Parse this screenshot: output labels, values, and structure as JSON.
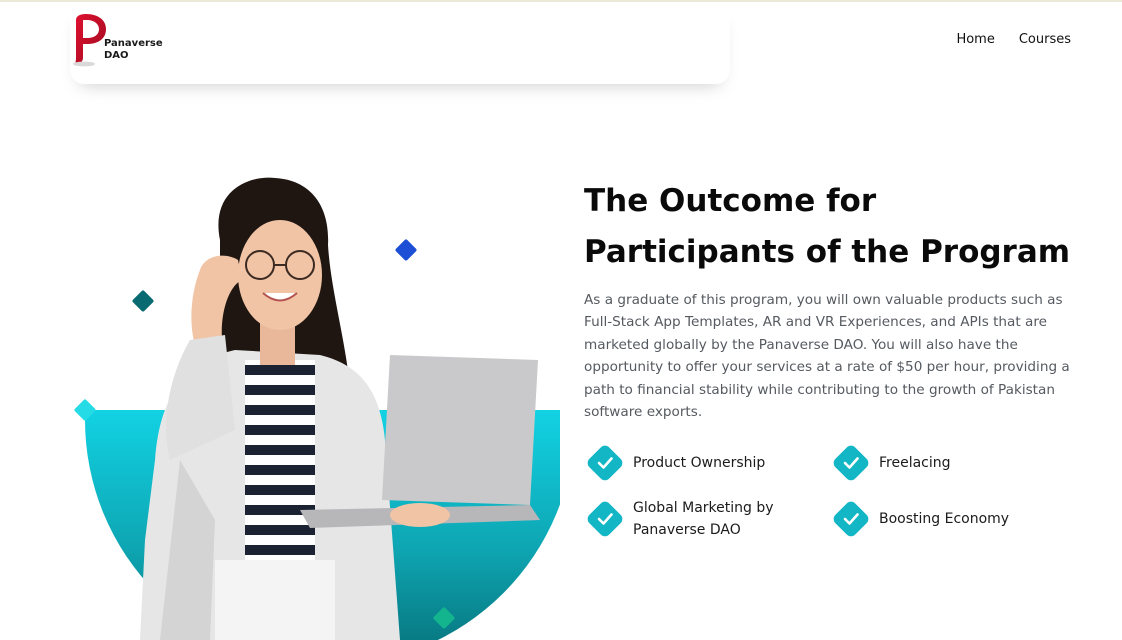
{
  "brand": {
    "line1": "Panaverse",
    "line2": "DAO",
    "logo_color": "#c8102e"
  },
  "nav": [
    {
      "label": "Home"
    },
    {
      "label": "Courses"
    }
  ],
  "hero": {
    "title_line1": "The Outcome for",
    "title_line2": "Participants of the Program",
    "description": "As a graduate of this program, you will own valuable products such as Full-Stack App Templates, AR and VR Experiences, and APIs that are marketed globally by the Panaverse DAO. You will also have the opportunity to offer your services at a rate of $50 per hour, providing a path to financial stability while contributing to the growth of Pakistan software exports."
  },
  "features": [
    {
      "label": "Product Ownership",
      "icon": "check-icon"
    },
    {
      "label": "Freelacing",
      "icon": "check-icon"
    },
    {
      "label": "Global Marketing by Panaverse DAO",
      "icon": "check-icon"
    },
    {
      "label": "Boosting Economy",
      "icon": "check-icon"
    }
  ],
  "colors": {
    "teal": "#10b5c3",
    "teal_dark": "#0a7f86",
    "blue_diamond": "#1d4fd6",
    "green_diamond": "#13b58f"
  }
}
